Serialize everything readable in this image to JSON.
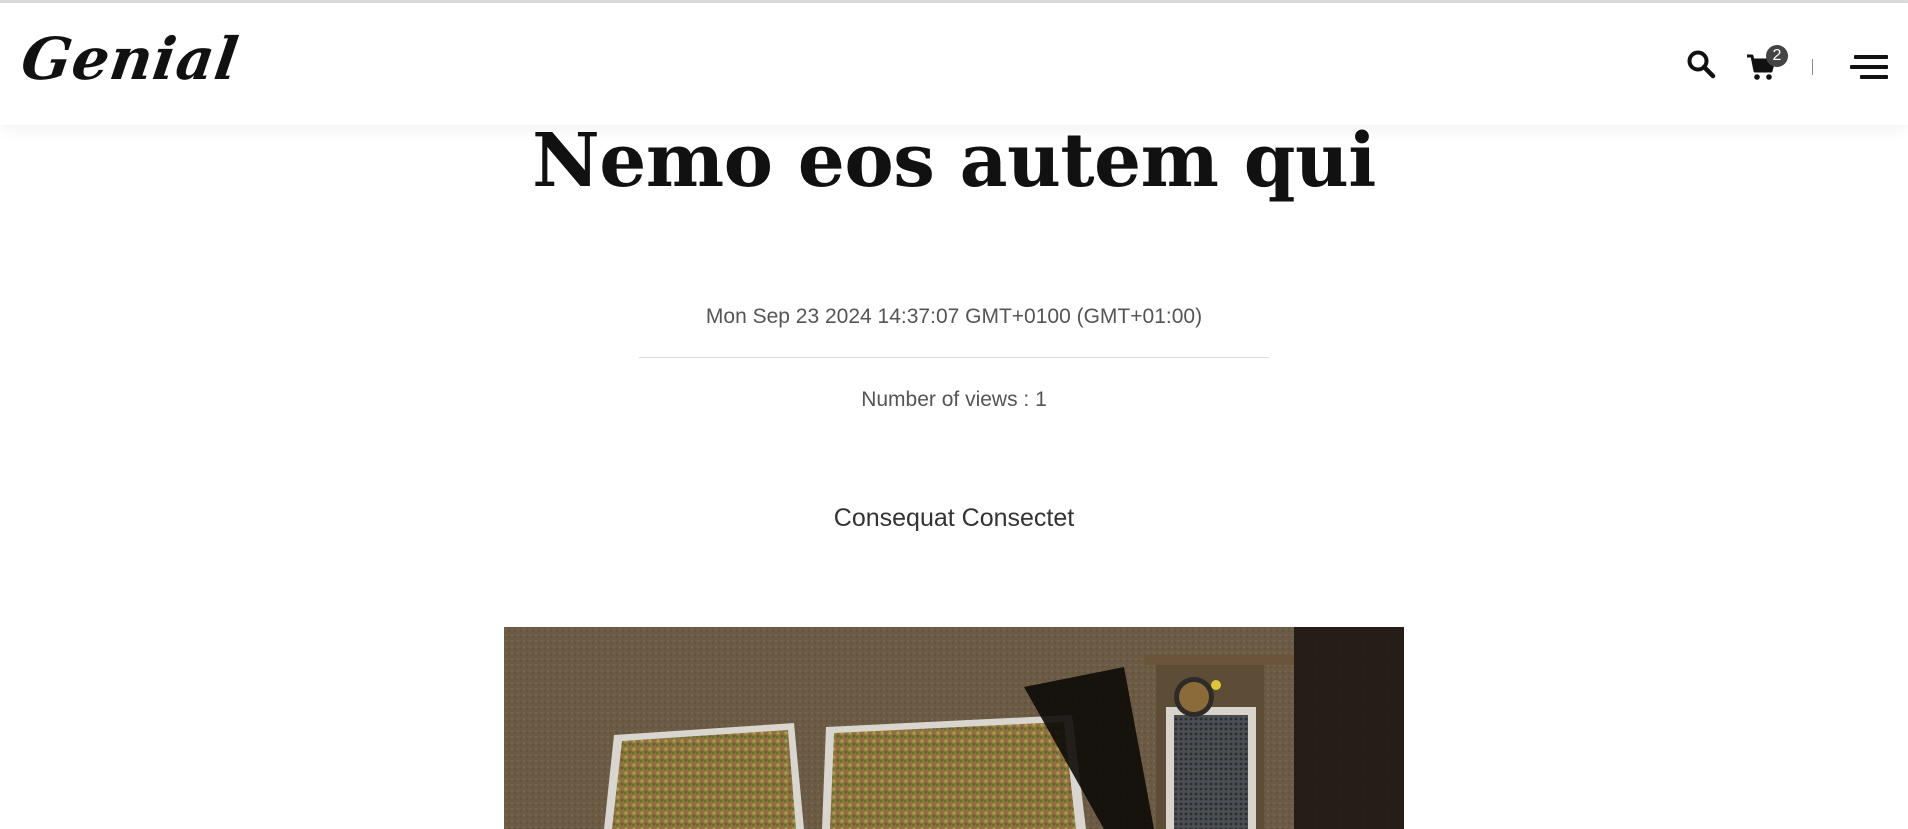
{
  "header": {
    "logo_text": "Genial",
    "cart_count": "2",
    "icons": [
      "search-icon",
      "cart-icon",
      "menu-icon"
    ]
  },
  "article": {
    "title": "Nemo eos autem qui",
    "date": "Mon Sep 23 2024 14:37:07 GMT+0100 (GMT+01:00)",
    "views": "Number of views : 1",
    "subtitle": "Consequat Consectet"
  },
  "colors": {
    "text": "#111111",
    "muted": "#555555",
    "badge": "#444444"
  }
}
